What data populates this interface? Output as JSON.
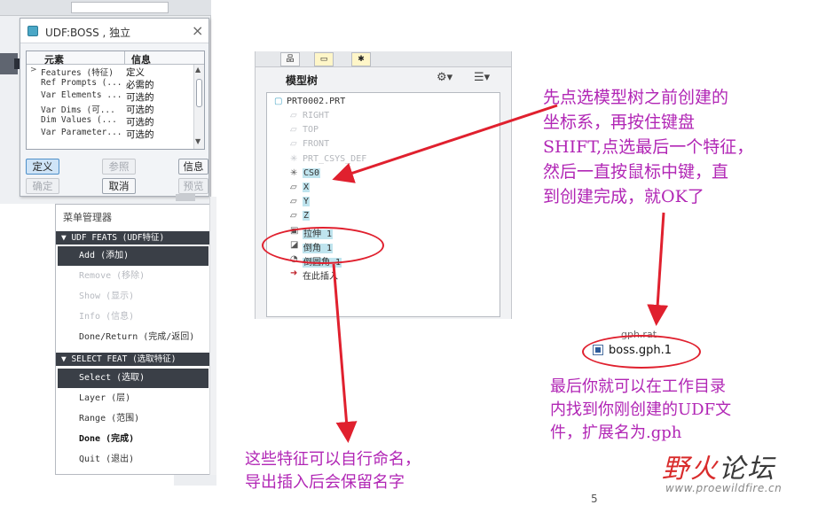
{
  "udf_dialog": {
    "title": "UDF:BOSS , 独立",
    "close_symbol": "×",
    "columns": {
      "element": "元素",
      "info": "信息"
    },
    "rows": [
      {
        "element": "Features (特征)",
        "info": "定义",
        "expander": ">"
      },
      {
        "element": "Ref Prompts (...",
        "info": "必需的"
      },
      {
        "element": "Var Elements ...",
        "info": "可选的"
      },
      {
        "element": "Var Dims (可...",
        "info": "可选的"
      },
      {
        "element": "Dim Values (...",
        "info": "可选的"
      },
      {
        "element": "Var Parameter...",
        "info": "可选的"
      }
    ],
    "buttons": {
      "define": "定义",
      "reference": "参照",
      "info": "信息",
      "ok": "确定",
      "cancel": "取消",
      "preview": "预览"
    }
  },
  "menu_manager": {
    "title": "菜单管理器",
    "udf_feats_header": "UDF FEATS (UDF特征)",
    "udf_feats_items": [
      {
        "label": "Add (添加)",
        "state": "selected"
      },
      {
        "label": "Remove (移除)",
        "state": "disabled"
      },
      {
        "label": "Show (显示)",
        "state": "disabled"
      },
      {
        "label": "Info (信息)",
        "state": "disabled"
      },
      {
        "label": "Done/Return (完成/返回)",
        "state": "normal"
      }
    ],
    "select_feat_header": "SELECT FEAT (选取特征)",
    "select_feat_items": [
      {
        "label": "Select (选取)",
        "state": "selected"
      },
      {
        "label": "Layer (层)",
        "state": "normal"
      },
      {
        "label": "Range (范围)",
        "state": "normal"
      },
      {
        "label": "Done (完成)",
        "state": "bold"
      },
      {
        "label": "Quit (退出)",
        "state": "normal"
      }
    ]
  },
  "model_tree": {
    "heading": "模型树",
    "root": "PRT0002.PRT",
    "nodes": [
      {
        "label": "RIGHT",
        "dim": true,
        "icon": "▱"
      },
      {
        "label": "TOP",
        "dim": true,
        "icon": "▱"
      },
      {
        "label": "FRONT",
        "dim": true,
        "icon": "▱"
      },
      {
        "label": "PRT_CSYS_DEF",
        "dim": true,
        "icon": "✳"
      },
      {
        "label": "CS0",
        "dim": false,
        "icon": "✳",
        "highlight": true
      },
      {
        "label": "X",
        "dim": false,
        "icon": "▱",
        "highlight": true
      },
      {
        "label": "Y",
        "dim": false,
        "icon": "▱",
        "highlight": true
      },
      {
        "label": "Z",
        "dim": false,
        "icon": "▱",
        "highlight": true
      },
      {
        "label": "拉伸 1",
        "dim": false,
        "icon": "▣",
        "highlight": true
      },
      {
        "label": "倒角 1",
        "dim": false,
        "icon": "◪",
        "highlight": true
      },
      {
        "label": "倒圆角 1",
        "dim": false,
        "icon": "◔",
        "highlight": true
      },
      {
        "label": "在此插入",
        "dim": false,
        "icon": "➜"
      }
    ]
  },
  "file": {
    "partial_label": "gph.rat",
    "name": "boss.gph.1"
  },
  "notes": {
    "note1": [
      "先点选模型树之前创建的",
      "坐标系，再按住键盘",
      "SHIFT,点选最后一个特征，",
      "然后一直按鼠标中键，直",
      "到创建完成，就OK了"
    ],
    "note2": [
      "这些特征可以自行命名，",
      "导出插入后会保留名字"
    ],
    "note3": [
      "最后你就可以在工作目录",
      "内找到你刚创建的UDF文",
      "件，扩展名为.gph"
    ]
  },
  "page_number": "5",
  "logo": {
    "text_red": "野火",
    "text_dark": "论坛",
    "url": "www.proewildfire.cn"
  },
  "colors": {
    "annotation_red": "#e0202e",
    "note_magenta": "#b126b5",
    "menu_dark": "#3a3f47",
    "tree_highlight": "#bfe4ee"
  }
}
